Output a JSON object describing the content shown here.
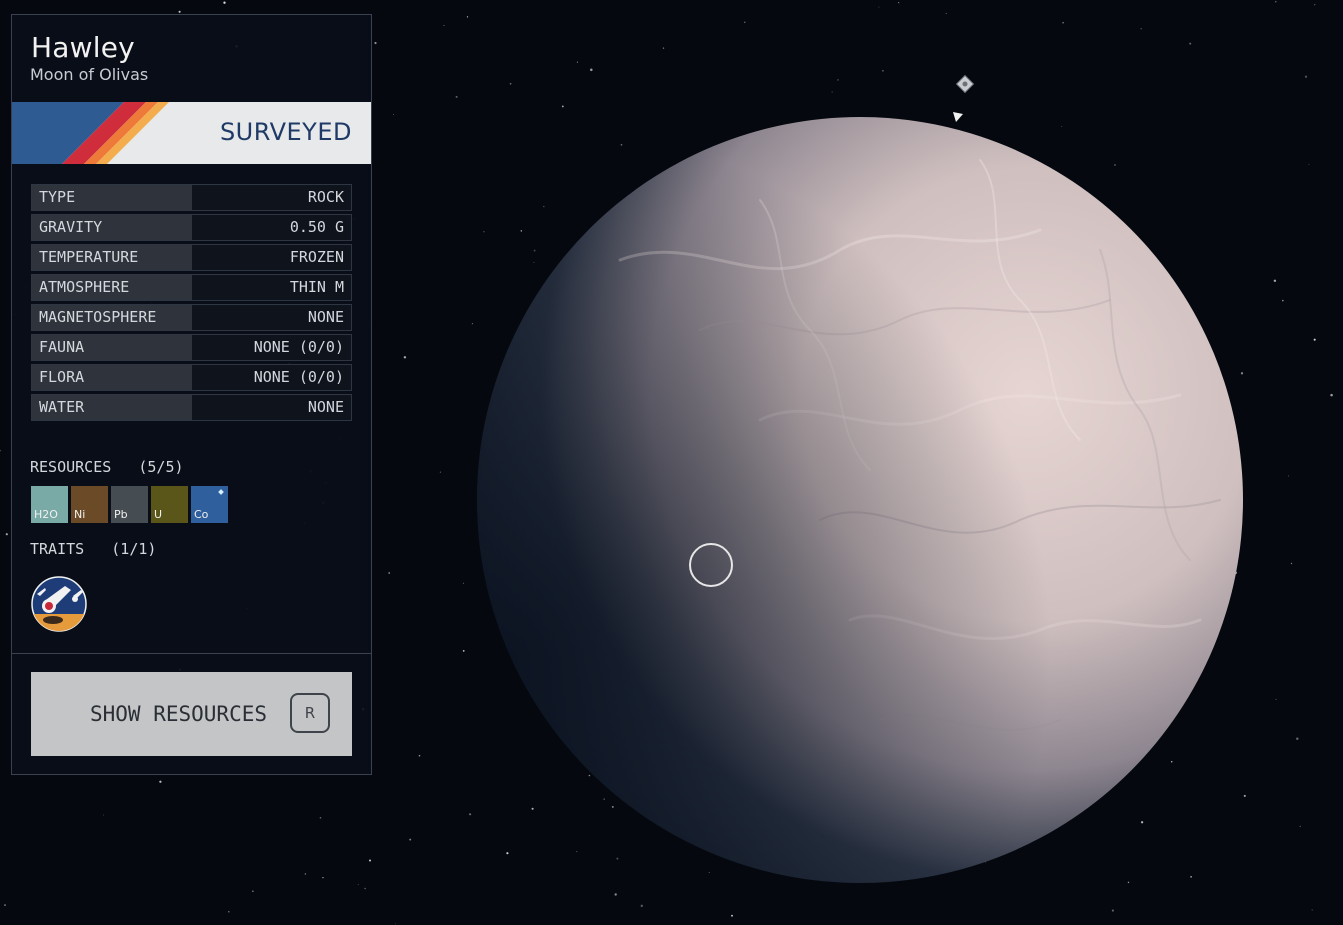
{
  "planet": {
    "name": "Hawley",
    "subtitle": "Moon of Olivas",
    "status": "SURVEYED"
  },
  "stats": [
    {
      "label": "TYPE",
      "value": "ROCK"
    },
    {
      "label": "GRAVITY",
      "value": "0.50 G"
    },
    {
      "label": "TEMPERATURE",
      "value": "FROZEN"
    },
    {
      "label": "ATMOSPHERE",
      "value": "THIN M"
    },
    {
      "label": "MAGNETOSPHERE",
      "value": "NONE"
    },
    {
      "label": "FAUNA",
      "value": "NONE (0/0)"
    },
    {
      "label": "FLORA",
      "value": "NONE (0/0)"
    },
    {
      "label": "WATER",
      "value": "NONE"
    }
  ],
  "resources": {
    "heading": "RESOURCES",
    "count": "(5/5)",
    "items": [
      {
        "symbol": "H2O",
        "color": "#79aaa6"
      },
      {
        "symbol": "Ni",
        "color": "#6b4a28"
      },
      {
        "symbol": "Pb",
        "color": "#454c52"
      },
      {
        "symbol": "U",
        "color": "#5a5519"
      },
      {
        "symbol": "Co",
        "color": "#2f5f9c"
      }
    ]
  },
  "traits": {
    "heading": "TRAITS",
    "count": "(1/1)",
    "icon": "meteor-trait-icon"
  },
  "actions": {
    "show_resources_label": "SHOW RESOURCES",
    "show_resources_key": "R"
  },
  "colors": {
    "banner_stripes": [
      "#2f5b93",
      "#cf2d3c",
      "#ee7a3a",
      "#f3ad4e"
    ],
    "status_text": "#1f3a66"
  }
}
